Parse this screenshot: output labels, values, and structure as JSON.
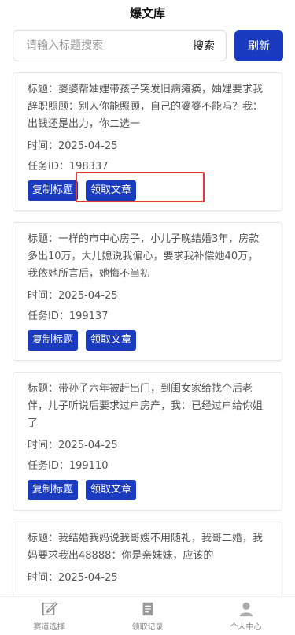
{
  "header": {
    "title": "爆文库"
  },
  "search": {
    "placeholder": "请输入标题搜索",
    "button_label": "搜索",
    "refresh_label": "刷新"
  },
  "cards": [
    {
      "title": "标题：婆婆帮妯娌带孩子突发旧病瘫痪，妯娌要求我辞职照顾：别人你能照顾，自己的婆婆不能吗？我：出钱还是出力，你二选一",
      "time": "时间：2025-04-25",
      "task": "任务ID：198337",
      "copy_label": "复制标题",
      "claim_label": "领取文章"
    },
    {
      "title": "标题：一样的市中心房子，小儿子晚结婚3年，房款多出10万，大儿媳说我偏心，要求我补偿她40万，我依她所言后，她悔不当初",
      "time": "时间：2025-04-25",
      "task": "任务ID：199137",
      "copy_label": "复制标题",
      "claim_label": "领取文章"
    },
    {
      "title": "标题：带孙子六年被赶出门，到闺女家给找个后老伴，儿子听说后要求过户房产，我：已经过户给你姐了",
      "time": "时间：2025-04-25",
      "task": "任务ID：199110",
      "copy_label": "复制标题",
      "claim_label": "领取文章"
    },
    {
      "title": "标题：我结婚我妈说我哥嫂不用随礼，我哥二婚，我妈要求我出48888：你是亲妹妹，应该的",
      "time": "时间：2025-04-25"
    }
  ],
  "tabbar": {
    "items": [
      {
        "label": "赛道选择",
        "icon": "edit-icon"
      },
      {
        "label": "领取记录",
        "icon": "document-icon"
      },
      {
        "label": "个人中心",
        "icon": "user-icon"
      }
    ]
  },
  "colors": {
    "accent": "#1a3bbf",
    "highlight": "#e53935"
  }
}
